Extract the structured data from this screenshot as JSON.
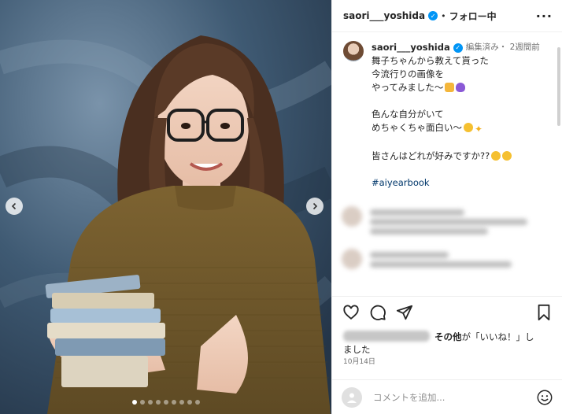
{
  "colors": {
    "verified": "#0095f6",
    "hashtag": "#00376b",
    "muted": "#737373"
  },
  "media": {
    "subject": "woman with glasses in brown knit sweater holding a stack of books",
    "dots_count": 9,
    "active_dot": 0
  },
  "header": {
    "username": "saori___yoshida",
    "separator": "•",
    "follow": "フォロー中",
    "more_icon": "more-horizontal-icon"
  },
  "caption": {
    "username": "saori___yoshida",
    "meta": "編集済み・ 2週間前",
    "lines": [
      "舞子ちゃんから教えて貰った",
      "今流行りの画像を",
      "やってみました〜",
      "色んな自分がいて",
      "めちゃくちゃ面白い〜",
      "皆さんはどれが好みですか??"
    ],
    "hashtag": "#aiyearbook"
  },
  "actions": {
    "icons": [
      "heart-icon",
      "comment-icon",
      "share-icon",
      "bookmark-icon"
    ]
  },
  "likes": {
    "suffix_bold": "その他",
    "suffix": "が「いいね！」し",
    "suffix2": "ました"
  },
  "date": "10月14日",
  "add_comment": {
    "placeholder": "コメントを追加..."
  }
}
